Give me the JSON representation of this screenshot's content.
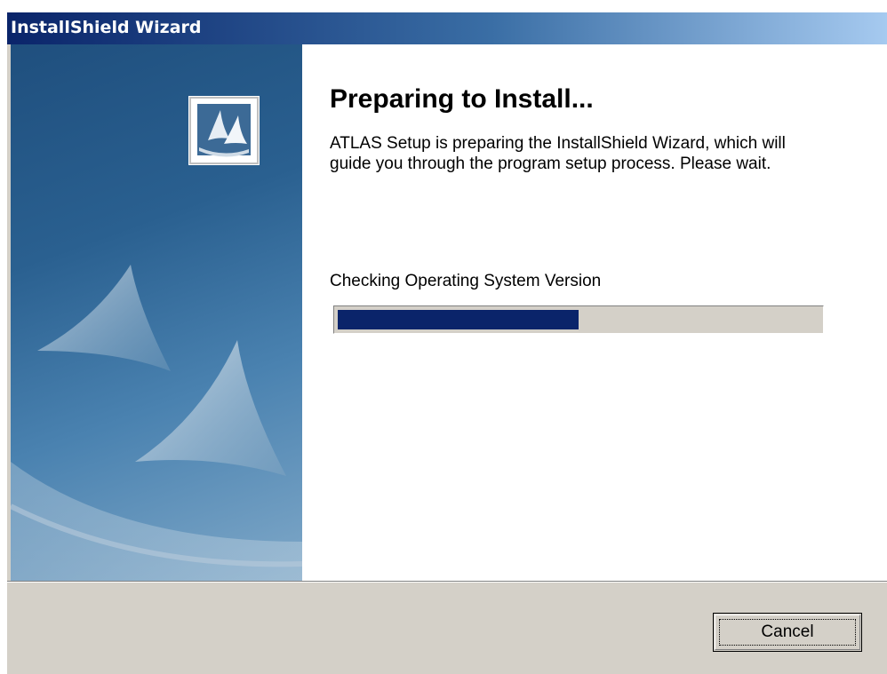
{
  "window": {
    "title": "InstallShield Wizard"
  },
  "content": {
    "heading": "Preparing to Install...",
    "description": "ATLAS Setup is preparing the InstallShield Wizard, which will guide you through the program setup process.  Please wait.",
    "status": "Checking Operating System Version",
    "progress_fraction": 0.5
  },
  "buttons": {
    "cancel": "Cancel"
  },
  "icons": {
    "logo": "installshield-logo-icon"
  },
  "colors": {
    "titlebar_start": "#0a246a",
    "titlebar_end": "#a6caf0",
    "progress_fill": "#0a246a",
    "dialog_face": "#d4d0c8"
  }
}
